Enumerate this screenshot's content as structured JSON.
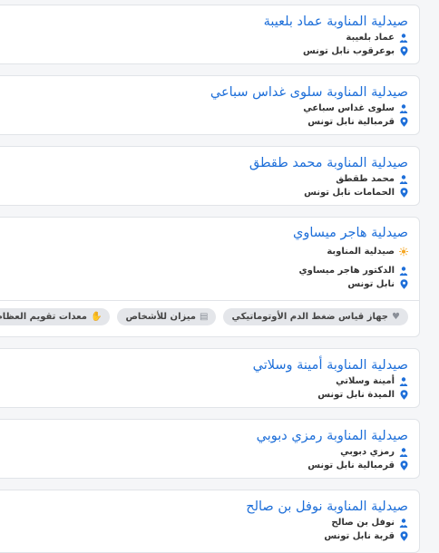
{
  "pharmacies": [
    {
      "name": "صيدلية المناوبة عماد بلعيبة",
      "pharmacist": "عماد بلعيبة",
      "location": "بوعرقوب نابل تونس"
    },
    {
      "name": "صيدلية المناوبة سلوى غداس سباعي",
      "pharmacist": "سلوى غداس سباعي",
      "location": "قرمبالية نابل تونس"
    },
    {
      "name": "صيدلية المناوبة محمد طقطق",
      "pharmacist": "محمد طقطق",
      "location": "الحمامات نابل تونس"
    },
    {
      "name": "صيدلية هاجر ميساوي",
      "status": "صيدلية المناوبة",
      "pharmacist": "الدكتور هاجر ميساوي",
      "location": "نابل تونس",
      "tags": [
        "جهاز قياس ضغط الدم الأوتوماتيكي",
        "ميزان للأشخاص",
        "معدات تقويم العظام"
      ]
    },
    {
      "name": "صيدلية المناوبة أمينة وسلاتي",
      "pharmacist": "أمينة وسلاتي",
      "location": "الميدة نابل تونس"
    },
    {
      "name": "صيدلية المناوبة رمزي دبوبي",
      "pharmacist": "رمزي دبوبي",
      "location": "قرمبالية نابل تونس"
    },
    {
      "name": "صيدلية المناوبة نوفل بن صالح",
      "pharmacist": "نوفل بن صالح",
      "location": "قربة نابل تونس"
    }
  ],
  "icons": {
    "person": "pharmacist-icon",
    "location": "location-pin-icon",
    "duty": "sun-icon"
  },
  "colors": {
    "title": "#1e6fd9",
    "icon_blue": "#1e6fd9",
    "sun": "#f5a623"
  }
}
